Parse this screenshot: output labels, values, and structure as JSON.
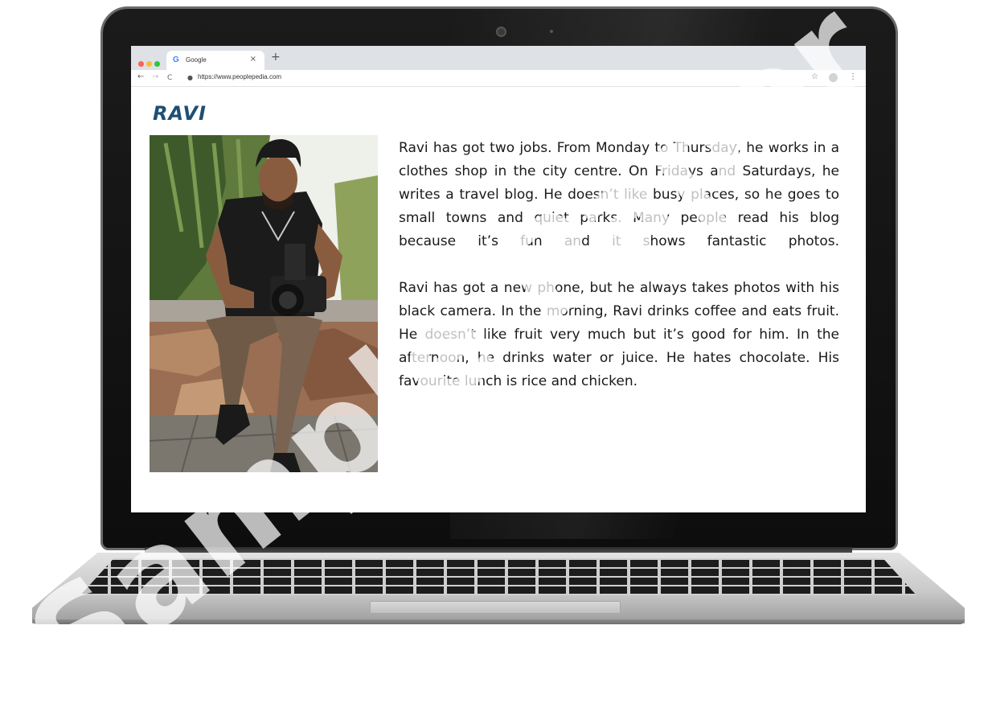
{
  "browser": {
    "tab_title": "Google",
    "favicon_letter": "G",
    "tab_close": "×",
    "new_tab": "+",
    "url": "https://www.peoplepedia.com",
    "back": "←",
    "forward": "→",
    "reload": "C",
    "lock": "🔒",
    "star": "☆",
    "menu": "⋮",
    "window_dot_colors": [
      "#ff5f57",
      "#febc2e",
      "#28c840"
    ]
  },
  "page": {
    "name": "RAVI",
    "paragraphs": [
      "Ravi has got two jobs. From Monday to Thursday, he works in a clothes shop in the city centre. On Fridays and Saturdays, he writes a travel blog. He doesn’t like busy places, so he goes to small towns and quiet parks. Many people read his blog because it’s fun and it shows fantastic photos.",
      "Ravi has got a new phone, but he always takes photos with his black camera. In the morning, Ravi drinks coffee and eats fruit. He doesn’t like fruit very much but it’s good for him. In the afternoon, he drinks water or juice. He hates chocolate. His favourite lunch is rice and chicken."
    ]
  },
  "watermark": "Sample Paper",
  "colors": {
    "name_color": "#1e4f73",
    "laptop_bezel": "#111111",
    "laptop_base": "#c9c9c9"
  }
}
